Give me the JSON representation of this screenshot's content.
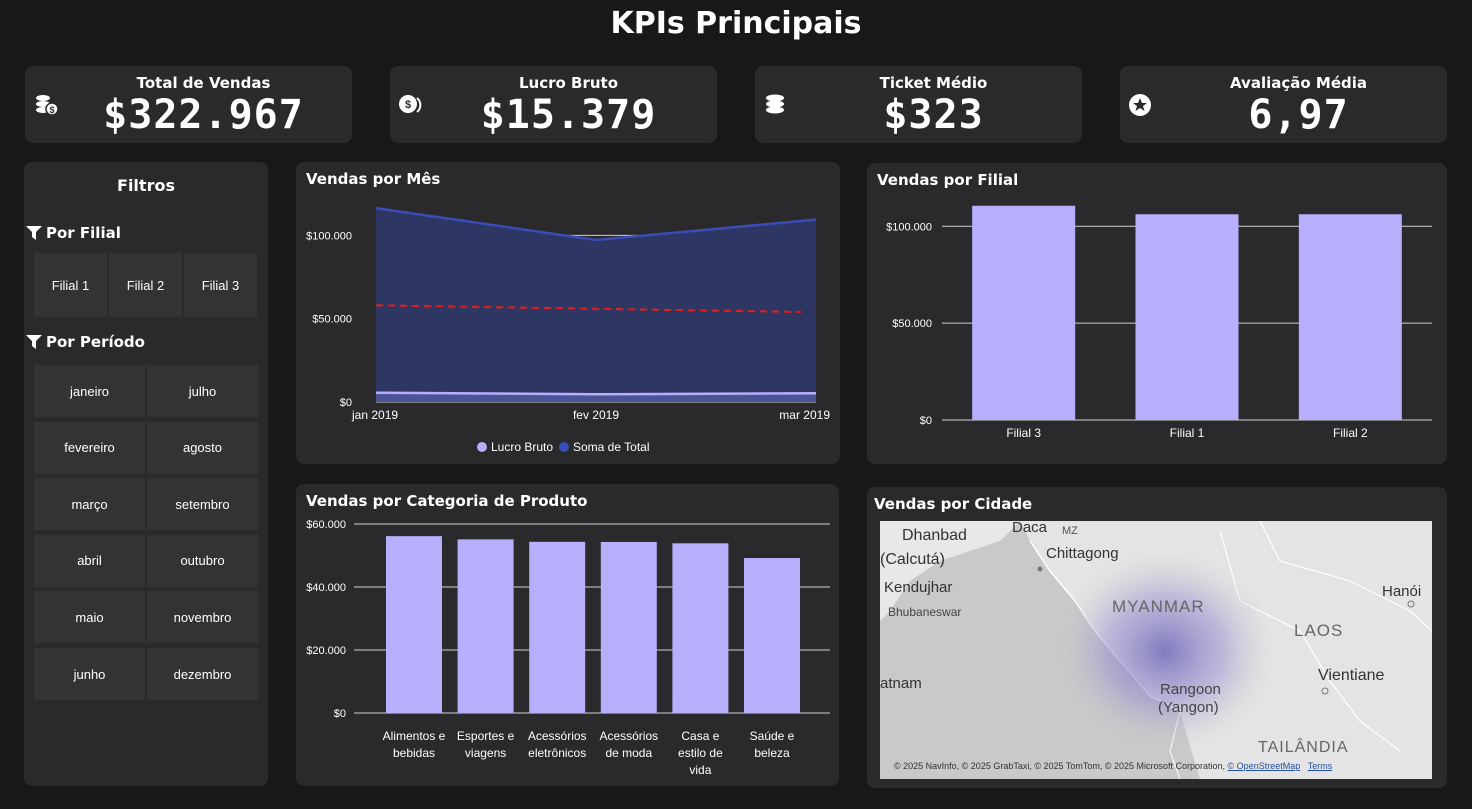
{
  "page": {
    "title": "KPIs Principais"
  },
  "kpis": [
    {
      "label": "Total de Vendas",
      "value": "$322.967",
      "icon": "money-bag-icon"
    },
    {
      "label": "Lucro Bruto",
      "value": "$15.379",
      "icon": "coins-icon"
    },
    {
      "label": "Ticket Médio",
      "value": "$323",
      "icon": "coin-stack-icon"
    },
    {
      "label": "Avaliação Média",
      "value": "6,97",
      "icon": "star-icon"
    }
  ],
  "filters": {
    "title": "Filtros",
    "branch_label": "Por Filial",
    "branches": [
      "Filial 1",
      "Filial 2",
      "Filial 3"
    ],
    "period_label": "Por Período",
    "months": [
      "janeiro",
      "julho",
      "fevereiro",
      "agosto",
      "março",
      "setembro",
      "abril",
      "outubro",
      "maio",
      "novembro",
      "junho",
      "dezembro"
    ]
  },
  "charts": {
    "month": {
      "title": "Vendas por Mês"
    },
    "branch": {
      "title": "Vendas por Filial"
    },
    "category": {
      "title": "Vendas por Categoria de Produto"
    },
    "city": {
      "title": "Vendas por Cidade"
    }
  },
  "map": {
    "labels": [
      "Dhanbad",
      "Daca",
      "MZ",
      "(Calcutá)",
      "Chittagong",
      "Kendujhar",
      "Bhubaneswar",
      "MYANMAR",
      "Hanói",
      "LAOS",
      "Vientiane",
      "atnam",
      "Rangoon",
      "(Yangon)",
      "TAILÂNDIA"
    ],
    "attribution": "© 2025 NavInfo, © 2025 GrabTaxi, © 2025 TomTom, © 2025 Microsoft Corporation,",
    "osm_link": "© OpenStreetMap",
    "terms_link": "Terms"
  },
  "chart_data": [
    {
      "type": "area",
      "title": "Vendas por Mês",
      "x": [
        "jan 2019",
        "fev 2019",
        "mar 2019"
      ],
      "series": [
        {
          "name": "Lucro Bruto",
          "values": [
            5537,
            4629,
            5213
          ],
          "color": "#b7aefc"
        },
        {
          "name": "Soma de Total",
          "values": [
            116292,
            97219,
            109456
          ],
          "color": "#2e3c8f"
        }
      ],
      "trend_line": {
        "values": [
          58000,
          54000
        ],
        "color": "#e02020",
        "style": "dashed"
      },
      "y_ticks": [
        "$0",
        "$50.000",
        "$100.000"
      ],
      "ylim": [
        0,
        120000
      ],
      "legend": "bottom",
      "grid": true
    },
    {
      "type": "bar",
      "title": "Vendas por Filial",
      "categories": [
        "Filial 3",
        "Filial 1",
        "Filial 2"
      ],
      "values": [
        110568,
        106200,
        106198
      ],
      "y_ticks": [
        "$0",
        "$50.000",
        "$100.000"
      ],
      "ylim": [
        0,
        112000
      ],
      "color": "#b7aefc",
      "grid": true
    },
    {
      "type": "bar",
      "title": "Vendas por Categoria de Produto",
      "categories": [
        "Alimentos e bebidas",
        "Esportes e viagens",
        "Acessórios eletrônicos",
        "Acessórios de moda",
        "Casa e estilo de vida",
        "Saúde e beleza"
      ],
      "category_lines": [
        [
          "Alimentos e",
          "bebidas"
        ],
        [
          "Esportes e",
          "viagens"
        ],
        [
          "Acessórios",
          "eletrônicos"
        ],
        [
          "Acessórios",
          "de moda"
        ],
        [
          "Casa e",
          "estilo de",
          "vida"
        ],
        [
          "Saúde e",
          "beleza"
        ]
      ],
      "values": [
        56145,
        55123,
        54338,
        54306,
        53862,
        49194
      ],
      "y_ticks": [
        "$0",
        "$20.000",
        "$40.000",
        "$60.000"
      ],
      "ylim": [
        0,
        60000
      ],
      "color": "#b7aefc",
      "grid": true
    }
  ]
}
